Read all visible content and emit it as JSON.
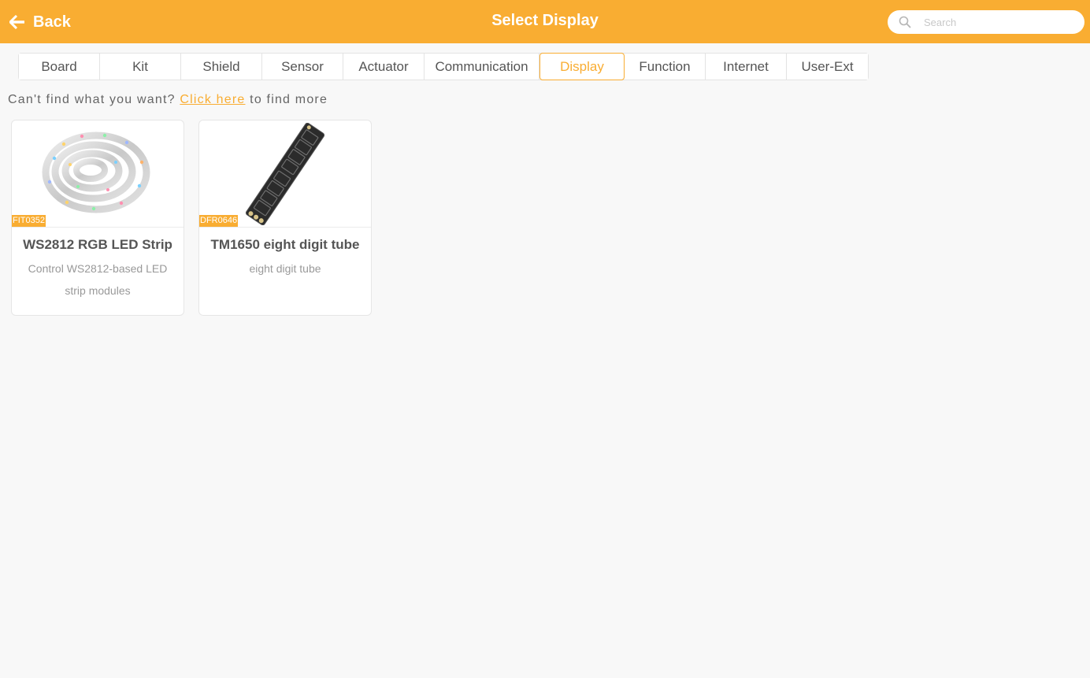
{
  "header": {
    "back_label": "Back",
    "title": "Select Display",
    "search_placeholder": "Search"
  },
  "tabs": [
    {
      "label": "Board",
      "active": false
    },
    {
      "label": "Kit",
      "active": false
    },
    {
      "label": "Shield",
      "active": false
    },
    {
      "label": "Sensor",
      "active": false
    },
    {
      "label": "Actuator",
      "active": false
    },
    {
      "label": "Communication",
      "active": false
    },
    {
      "label": "Display",
      "active": true
    },
    {
      "label": "Function",
      "active": false
    },
    {
      "label": "Internet",
      "active": false
    },
    {
      "label": "User-Ext",
      "active": false
    }
  ],
  "hint": {
    "prefix": "Can't find what you want?",
    "link": "Click here",
    "suffix": "to find more"
  },
  "cards": [
    {
      "sku": "FIT0352",
      "name": "WS2812 RGB LED Strip",
      "desc": "Control WS2812-based LED strip modules",
      "image": "led-strip-image"
    },
    {
      "sku": "DFR0646",
      "name": "TM1650 eight digit tube",
      "desc": "eight digit tube",
      "image": "eight-digit-tube-image"
    }
  ],
  "colors": {
    "accent": "#f9ad32",
    "background": "#f8f8f8"
  }
}
